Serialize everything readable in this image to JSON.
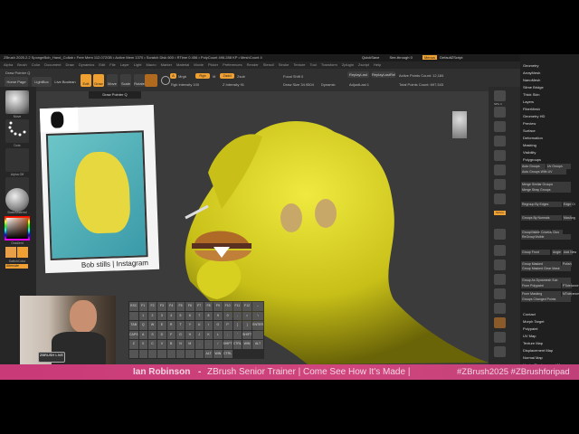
{
  "titlebar": "ZBrush 2025.2.2   SpongeBob_Hand_Collab  • Free Mem 112.072GB • Active Mem 1370 • Scratch Disk 600 • RTime 0.456 • PolyCount 496.288 KP • MeshCount 4",
  "menu": [
    "Alpha",
    "Brush",
    "Color",
    "Document",
    "Draw",
    "Dynamics",
    "Edit",
    "File",
    "Layer",
    "Light",
    "Macro",
    "Marker",
    "Material",
    "Movie",
    "Picker",
    "Preferences",
    "Render",
    "Stencil",
    "Stroke",
    "Texture",
    "Tool",
    "Transform",
    "Zplugin",
    "Zscript",
    "Help"
  ],
  "topright": {
    "quicksave": "QuickSave",
    "seethrough": "See-through  0",
    "menus": "Menus",
    "script": "DefaultZScript"
  },
  "tool_label": "Draw Pointer Q",
  "tooltip": "Draw Pointer Q",
  "toolbar": {
    "home": "Home Page",
    "lightbox": "LightBox",
    "liveboolean": "Live Boolean",
    "edit": "Edit",
    "draw": "Draw",
    "move": "Move",
    "scale": "Scale",
    "rotate": "Rotate",
    "a": "A",
    "mrgb": "Mrgb",
    "rgb": "Rgb",
    "m": "M",
    "zadd": "Zadd",
    "zsub": "Zsub",
    "rgb_intensity": "Rgb Intensity 100",
    "z_intensity": "Z Intensity 91",
    "focal_shift": "Focal Shift 0",
    "draw_size": "Draw Size 34.9504",
    "dynamic": "Dynamic",
    "replaylast": "ReplayLast",
    "replaylastrel": "ReplayLastRel",
    "adjustlast": "AdjustLast 1",
    "active_points": "Active Points Count: 12,184",
    "total_points": "Total Points Count: 697,543"
  },
  "leftshelf": [
    "Move",
    "Dots",
    "Alpha Off",
    "Texture Off",
    "BasicMaterial",
    "Gradient",
    "SwitchColor",
    "Alternate"
  ],
  "righttray": [
    "SPix 3",
    "Scroll",
    "Zoom",
    "Actual",
    "AAHalf",
    "Persp",
    "Floor",
    "Dynamic",
    "L.Sym",
    "Gizmo",
    "Frame",
    "Move",
    "Zoom3D",
    "Rotate",
    "Line Fill",
    "Transp",
    "Ghost",
    "Solo",
    "Xpose"
  ],
  "rpanel": {
    "top": [
      "Geometry",
      "ArrayMesh",
      "NanoMesh",
      "Slime Bridge",
      "Thick Skin",
      "Layers",
      "FiberMesh",
      "Geometry HD",
      "Preview",
      "Surface",
      "Deformation",
      "Masking",
      "Visibility",
      "Polygroups"
    ],
    "buttons": [
      "Auto Groups",
      "Uv Groups",
      "Auto Groups With UV",
      "Merge Similar Groups",
      "Merge Stray Groups",
      "Regroup By Edges",
      "Edge Ct",
      "Groups By Normals",
      "MaxAng",
      "GroupVisible",
      "Coverage",
      "Clus",
      "ReGroupVisible",
      "Group Front",
      "Angle",
      "Add New",
      "Group Masked",
      "Polish",
      "Group Masked Clear Mask",
      "Group As Dynamesh Sub",
      "From Polypaint",
      "PTolerance",
      "From Masking",
      "MTolerance",
      "Groups Changed Points"
    ],
    "bottom": [
      "Contact",
      "Morph Target",
      "Polypaint",
      "UV Map",
      "Texture Map",
      "Displacement Map",
      "Normal Map",
      "Vector Displacement Map"
    ]
  },
  "ref_caption": "Bob stills | Instagram",
  "keyboard": [
    "ESC",
    "F1",
    "F2",
    "F3",
    "F4",
    "F5",
    "F6",
    "F7",
    "F8",
    "F9",
    "F10",
    "F11",
    "F12",
    "←",
    "`",
    "1",
    "2",
    "3",
    "4",
    "5",
    "6",
    "7",
    "8",
    "9",
    "0",
    "-",
    "=",
    "\\",
    "TAB",
    "Q",
    "W",
    "E",
    "R",
    "T",
    "Y",
    "U",
    "I",
    "O",
    "P",
    "[",
    "]",
    "ENTER",
    "CAPS",
    "A",
    "S",
    "D",
    "F",
    "G",
    "H",
    "J",
    "K",
    "L",
    ";",
    "'",
    "SHIFT",
    "",
    "Z",
    "X",
    "C",
    "V",
    "B",
    "N",
    "M",
    ",",
    ".",
    "/",
    "SHIFT",
    "CTRL",
    "WIN",
    "ALT",
    "",
    "",
    "",
    "",
    "",
    "",
    "",
    "",
    "ALT",
    "WIN",
    "CTRL"
  ],
  "live_logo": "ZBRUSH LIVE",
  "banner": {
    "name": "Ian Robinson",
    "sep": "-",
    "title": "ZBrush Senior Trainer | Come See How It's Made |",
    "tags": "#ZBrush2025 #ZBrushforipad"
  },
  "colors": {
    "accent": "#f0a030",
    "banner": "#c83a78",
    "model": "#d8d020"
  }
}
